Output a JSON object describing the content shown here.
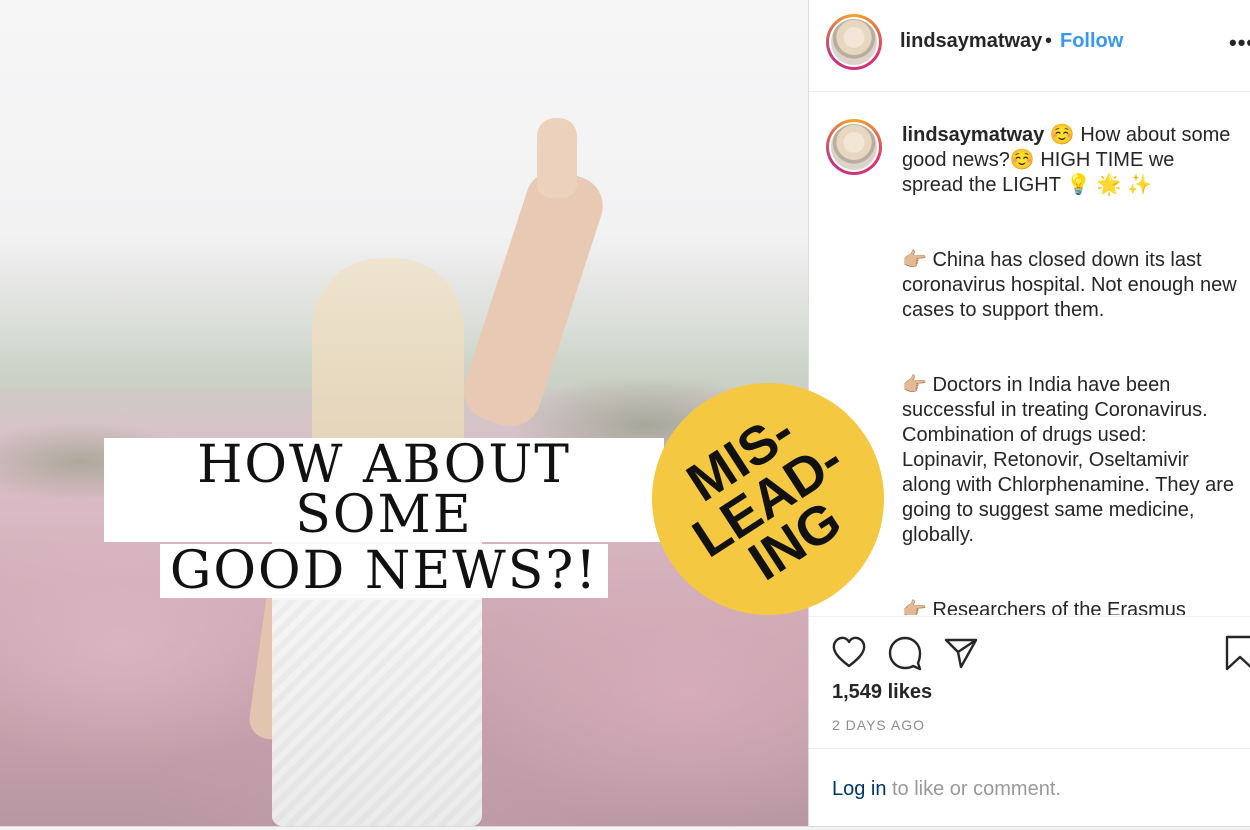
{
  "post": {
    "image": {
      "headline_line1": "HOW ABOUT SOME",
      "headline_line2": "GOOD NEWS?!",
      "badge": {
        "line1": "MIS-",
        "line2": "LEAD-",
        "line3": "ING",
        "color": "#f5c842"
      }
    },
    "header": {
      "username": "lindsaymatway",
      "separator": "•",
      "follow_label": "Follow",
      "more_label": "•••"
    },
    "caption": {
      "username": "lindsaymatway",
      "intro": "☺️ How about some good news?☺️  HIGH TIME we spread the LIGHT 💡 🌟 ✨",
      "points": [
        {
          "bullet": "👉🏼",
          "text": "China has closed down its last coronavirus hospital. Not enough new cases to support them."
        },
        {
          "bullet": "👉🏼",
          "text": "Doctors in India have been successful in treating Coronavirus. Combination of drugs used: Lopinavir, Retonovir, Oseltamivir along with Chlorphenamine. They are going to suggest same medicine, globally."
        },
        {
          "bullet": "👉🏼",
          "text": "Researchers of the Erasmus Medical Center claim to have found"
        }
      ]
    },
    "actions": {
      "like_icon": "heart-icon",
      "comment_icon": "comment-icon",
      "share_icon": "paper-plane-icon",
      "save_icon": "bookmark-icon"
    },
    "likes": "1,549 likes",
    "time_ago": "2 DAYS AGO",
    "login": {
      "link": "Log in",
      "rest": " to like or comment."
    },
    "colors": {
      "link_blue": "#3897f0",
      "login_navy": "#003569",
      "muted": "#8e8e8e"
    }
  }
}
